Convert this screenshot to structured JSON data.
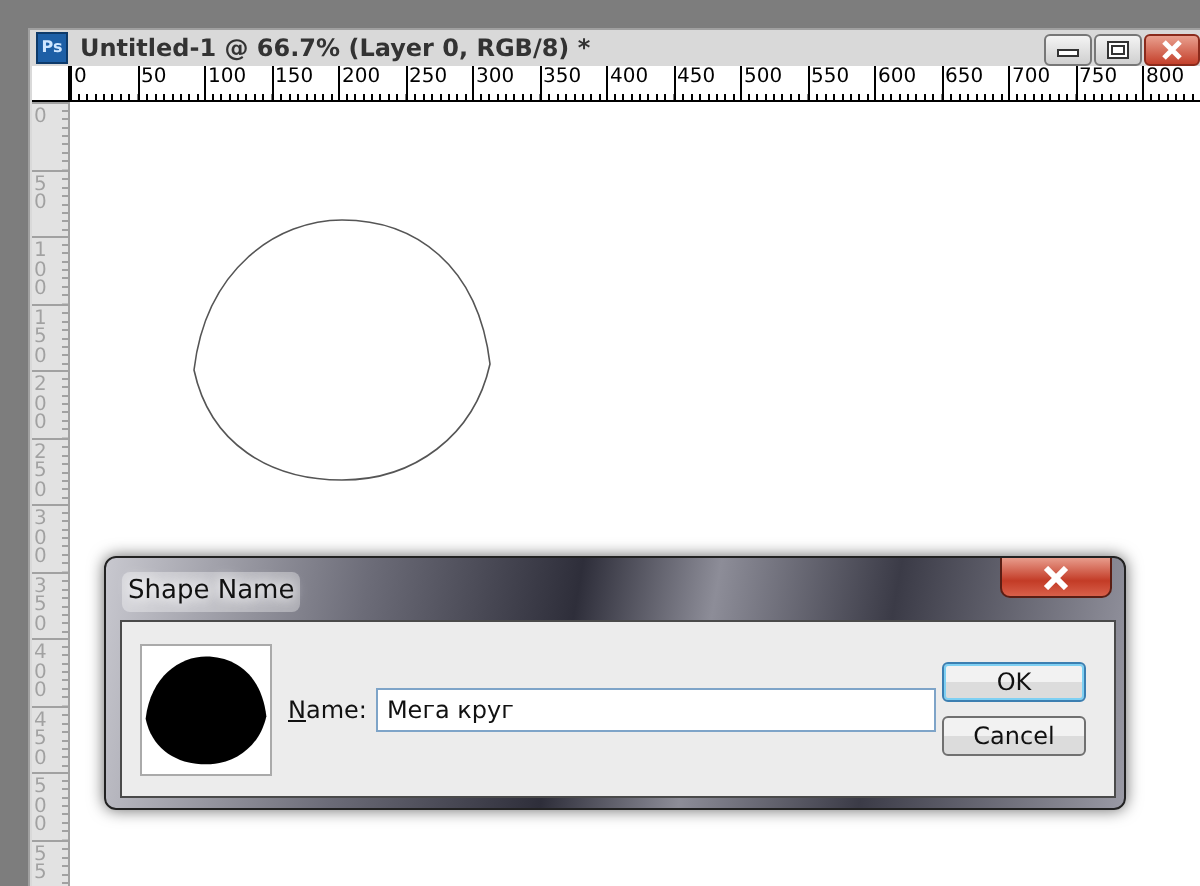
{
  "document_window": {
    "app_icon": "Ps",
    "title": "Untitled-1 @ 66.7% (Layer 0, RGB/8) *"
  },
  "rulers": {
    "horizontal": [
      "0",
      "50",
      "100",
      "150",
      "200",
      "250",
      "300",
      "350",
      "400",
      "450",
      "500",
      "550",
      "600",
      "650",
      "700",
      "750",
      "800"
    ],
    "vertical": [
      "0",
      "50",
      "100",
      "150",
      "200",
      "250",
      "300",
      "350",
      "400",
      "450",
      "500",
      "55"
    ]
  },
  "dialog": {
    "title": "Shape Name",
    "name_label": "Name:",
    "name_value": "Мега круг",
    "buttons": [
      {
        "label": "OK",
        "default": true
      },
      {
        "label": "Cancel",
        "default": false
      }
    ]
  }
}
